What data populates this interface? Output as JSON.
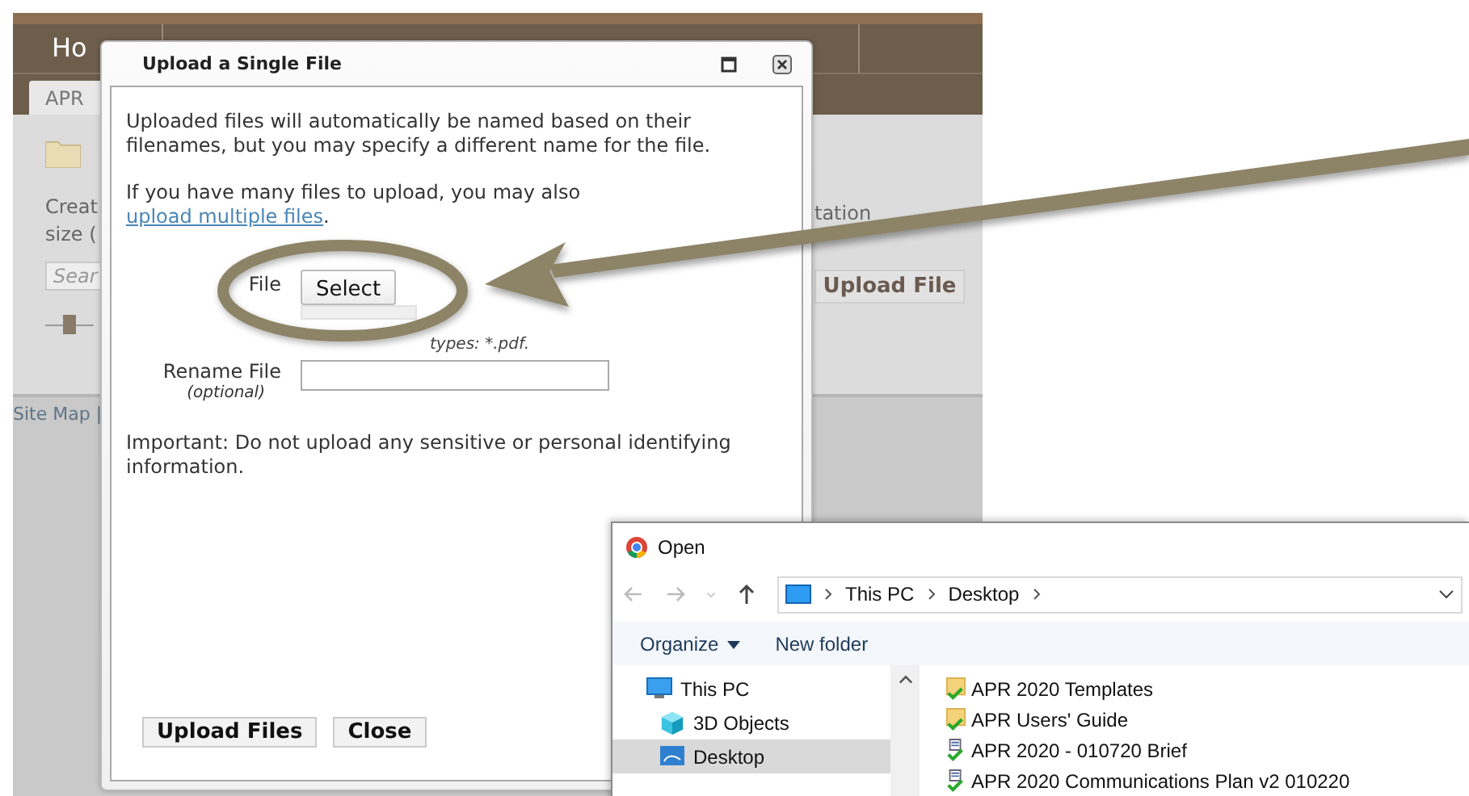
{
  "background_page": {
    "nav_tab": "Ho",
    "sub_tab": "APR",
    "description_lines": [
      "Creat",
      "size ("
    ],
    "search": {
      "placeholder": "Sear"
    },
    "slider": {
      "level": 0.5
    },
    "cut_text": "tation",
    "upload_button": "Upload File",
    "footer_link": "Site Map |"
  },
  "upload_dialog": {
    "title": "Upload a Single File",
    "intro": "Uploaded files will automatically be named based on their filenames, but you may specify a different name for the file.",
    "multiple_text": "If you have many files to upload, you may also ",
    "multiple_link": "upload multiple files",
    "multiple_end": ".",
    "file_label": "File",
    "select_button": "Select",
    "accepted_types": "types: *.pdf.",
    "rename_label": "Rename File",
    "rename_hint": "(optional)",
    "notice": "Important: Do not upload any sensitive or personal identifying information.",
    "buttons": [
      "Upload Files",
      "Close"
    ]
  },
  "open_dialog": {
    "title": "Open",
    "path": [
      "This PC",
      "Desktop"
    ],
    "toolbar": [
      "Organize",
      "New folder"
    ],
    "nav_tree": [
      {
        "label": "This PC",
        "kind": "computer",
        "selected": false,
        "children": [
          {
            "label": "3D Objects",
            "kind": "cube",
            "selected": false
          },
          {
            "label": "Desktop",
            "kind": "desktop",
            "selected": true
          }
        ]
      }
    ],
    "files": [
      {
        "name": "APR 2020 Templates",
        "kind": "folder"
      },
      {
        "name": "APR Users' Guide",
        "kind": "folder"
      },
      {
        "name": "APR 2020 - 010720 Brief",
        "kind": "document"
      },
      {
        "name": "APR 2020 Communications Plan v2 010220",
        "kind": "document"
      }
    ]
  }
}
